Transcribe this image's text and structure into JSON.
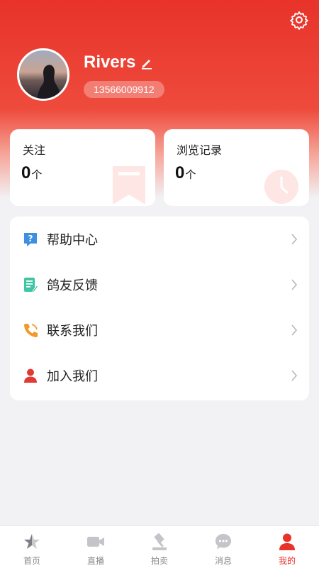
{
  "profile": {
    "username": "Rivers",
    "phone": "13566009912"
  },
  "stats": [
    {
      "label": "关注",
      "value": "0",
      "unit": "个"
    },
    {
      "label": "浏览记录",
      "value": "0",
      "unit": "个"
    }
  ],
  "menu": [
    {
      "label": "帮助中心",
      "icon": "help-icon",
      "color": "#3d8fe0"
    },
    {
      "label": "鸽友反馈",
      "icon": "feedback-icon",
      "color": "#3ec6a3"
    },
    {
      "label": "联系我们",
      "icon": "phone-icon",
      "color": "#f19a2b"
    },
    {
      "label": "加入我们",
      "icon": "user-icon",
      "color": "#e03a32"
    }
  ],
  "tabbar": [
    {
      "label": "首页",
      "icon": "home-star-icon",
      "active": false
    },
    {
      "label": "直播",
      "icon": "video-icon",
      "active": false
    },
    {
      "label": "拍卖",
      "icon": "auction-hammer-icon",
      "active": false
    },
    {
      "label": "消息",
      "icon": "message-icon",
      "active": false
    },
    {
      "label": "我的",
      "icon": "profile-icon",
      "active": true
    }
  ],
  "colors": {
    "brand": "#e8332a",
    "tab_inactive": "#888888",
    "background": "#f2f2f5"
  }
}
